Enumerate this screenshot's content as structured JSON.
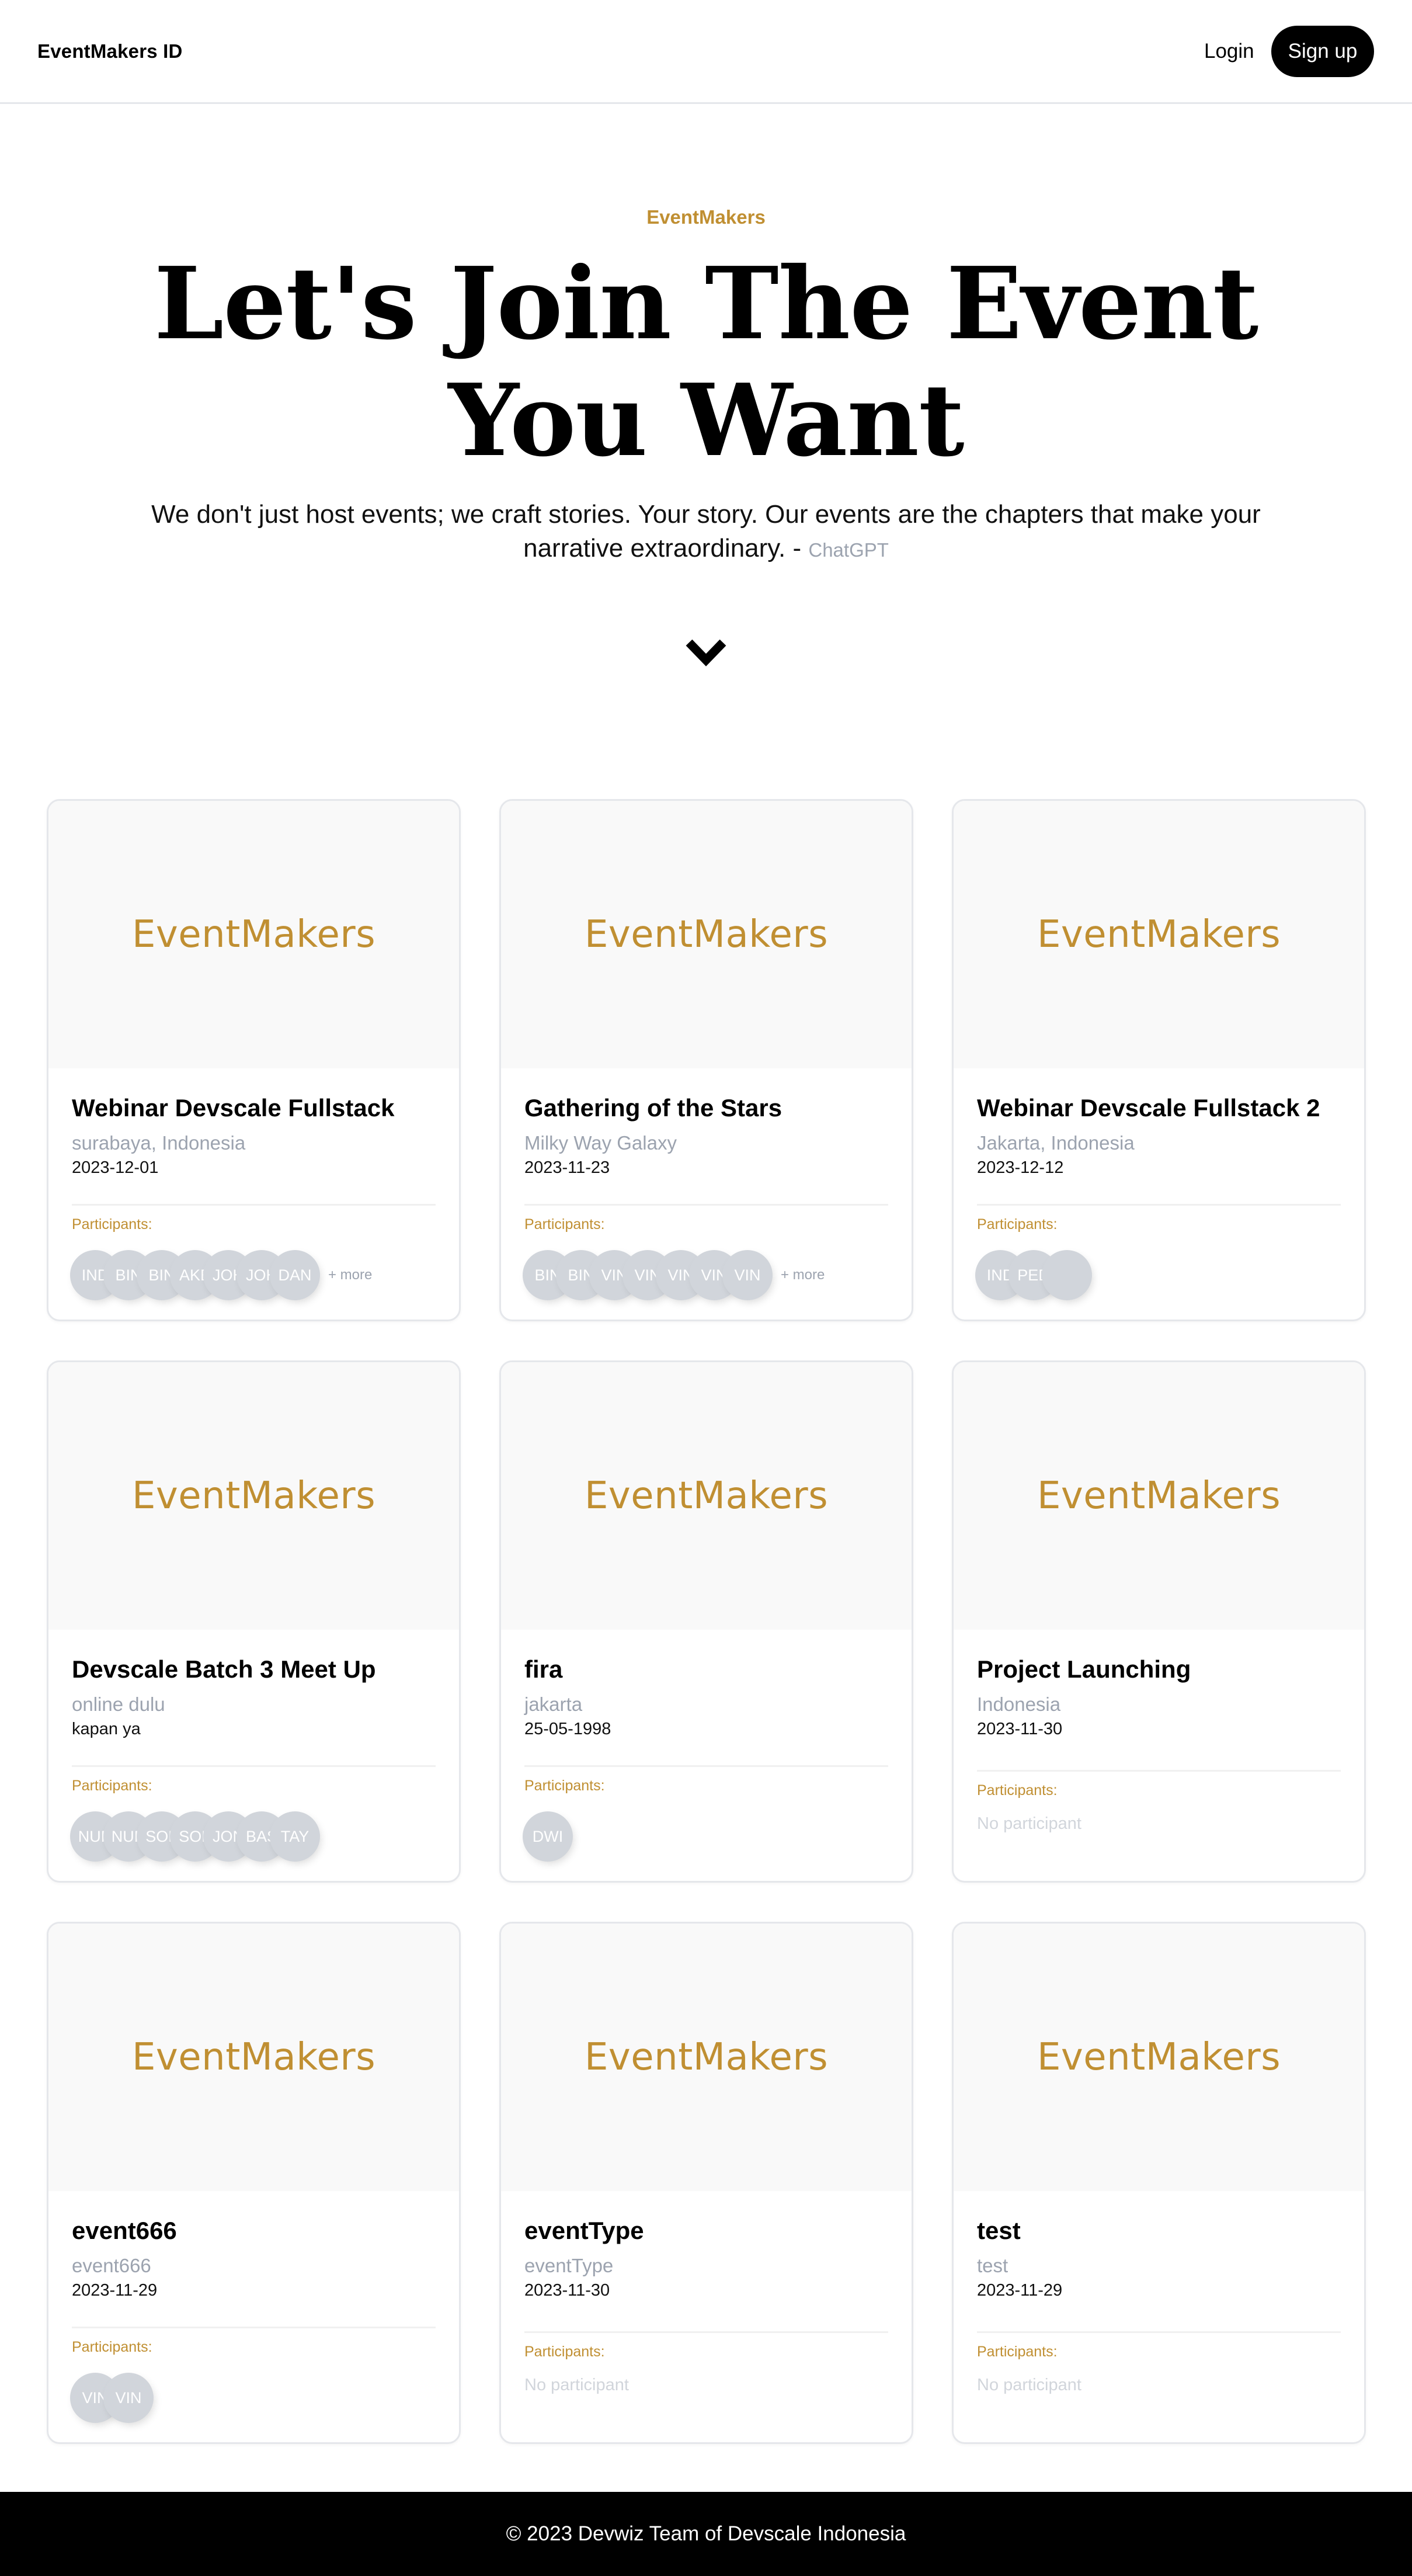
{
  "navbar": {
    "brand": "EventMakers ID",
    "login": "Login",
    "signup": "Sign up"
  },
  "hero": {
    "eyebrow": "EventMakers",
    "title_line1": "Let's Join The Event",
    "title_line2": "You Want",
    "subtitle": "We don't just host events; we craft stories. Your story. Our events are the chapters that make your narrative extraordinary. -",
    "credit": "ChatGPT"
  },
  "cards": [
    {
      "logo": "EventMakers",
      "title": "Webinar Devscale Fullstack",
      "location": "surabaya, Indonesia",
      "date": "2023-12-01",
      "participants_label": "Participants:",
      "participants": [
        "IND",
        "BIN",
        "BIN",
        "AKE",
        "JOH",
        "JOH",
        "DAN"
      ],
      "more": "+ more",
      "no_participant": ""
    },
    {
      "logo": "EventMakers",
      "title": "Gathering of the Stars",
      "location": "Milky Way Galaxy",
      "date": "2023-11-23",
      "participants_label": "Participants:",
      "participants": [
        "BIN",
        "BIN",
        "VIN",
        "VIN",
        "VIN",
        "VIN",
        "VIN"
      ],
      "more": "+ more",
      "no_participant": ""
    },
    {
      "logo": "EventMakers",
      "title": "Webinar Devscale Fullstack 2",
      "location": "Jakarta, Indonesia",
      "date": "2023-12-12",
      "participants_label": "Participants:",
      "participants": [
        "IND",
        "PED",
        ""
      ],
      "more": "",
      "no_participant": ""
    },
    {
      "logo": "EventMakers",
      "title": "Devscale Batch 3 Meet Up",
      "location": "online dulu",
      "date": "kapan ya",
      "participants_label": "Participants:",
      "participants": [
        "NUR",
        "NUR",
        "SOF",
        "SOF",
        "JON",
        "BAS",
        "TAY"
      ],
      "more": "",
      "no_participant": ""
    },
    {
      "logo": "EventMakers",
      "title": "fira",
      "location": "jakarta",
      "date": "25-05-1998",
      "participants_label": "Participants:",
      "participants": [
        "DWI"
      ],
      "more": "",
      "no_participant": ""
    },
    {
      "logo": "EventMakers",
      "title": "Project Launching",
      "location": "Indonesia",
      "date": "2023-11-30",
      "participants_label": "Participants:",
      "participants": [],
      "more": "",
      "no_participant": "No participant"
    },
    {
      "logo": "EventMakers",
      "title": "event666",
      "location": "event666",
      "date": "2023-11-29",
      "participants_label": "Participants:",
      "participants": [
        "VIN",
        "VIN"
      ],
      "more": "",
      "no_participant": ""
    },
    {
      "logo": "EventMakers",
      "title": "eventType",
      "location": "eventType",
      "date": "2023-11-30",
      "participants_label": "Participants:",
      "participants": [],
      "more": "",
      "no_participant": "No participant"
    },
    {
      "logo": "EventMakers",
      "title": "test",
      "location": "test",
      "date": "2023-11-29",
      "participants_label": "Participants:",
      "participants": [],
      "more": "",
      "no_participant": "No participant"
    }
  ],
  "footer": {
    "text": "© 2023 Devwiz Team of Devscale Indonesia"
  },
  "colors": {
    "accent": "#c08f32",
    "muted": "#9ca3af",
    "avatar": "#d1d5db",
    "footer_bg": "#000000"
  },
  "icons": {
    "scroll_down": "chevron-down-icon"
  }
}
